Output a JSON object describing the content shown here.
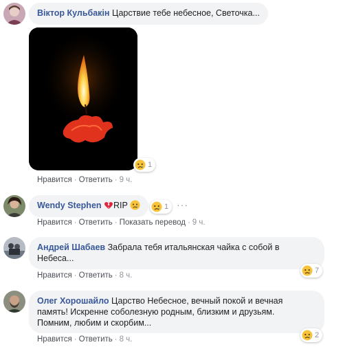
{
  "comments": [
    {
      "author": "Віктор Кульбакін",
      "text": "Царствие тебе небесное, Светочка...",
      "reaction_count": "1",
      "actions": {
        "like": "Нравится",
        "reply": "Ответить",
        "time": "9 ч."
      }
    },
    {
      "author": "Wendy Stephen",
      "text": "RIP",
      "reaction_count": "1",
      "actions": {
        "like": "Нравится",
        "reply": "Ответить",
        "translate": "Показать перевод",
        "time": "9 ч."
      }
    },
    {
      "author": "Андрей Шабаев",
      "text_line1": "Забрала тебя итальянская чайка с собой в",
      "text_line2": "Небеса...",
      "reaction_count": "7",
      "actions": {
        "like": "Нравится",
        "reply": "Ответить",
        "time": "8 ч."
      }
    },
    {
      "author": "Олег Хорошайло",
      "text_line1": "Царство Небесное, вечный покой и вечная",
      "text_line2": "память! Искренне соболезную родным, близким и друзьям.",
      "text_line3": "Помним, любим и скорбим...",
      "reaction_count": "2",
      "actions": {
        "like": "Нравится",
        "reply": "Ответить",
        "time": "8 ч."
      }
    }
  ],
  "icons": {
    "reaction": "sad-reaction-icon",
    "broken_heart": "broken-heart-icon",
    "more": "more-options-icon"
  },
  "colors": {
    "author": "#385898",
    "bubble": "#f2f3f5",
    "meta": "#90949c"
  }
}
